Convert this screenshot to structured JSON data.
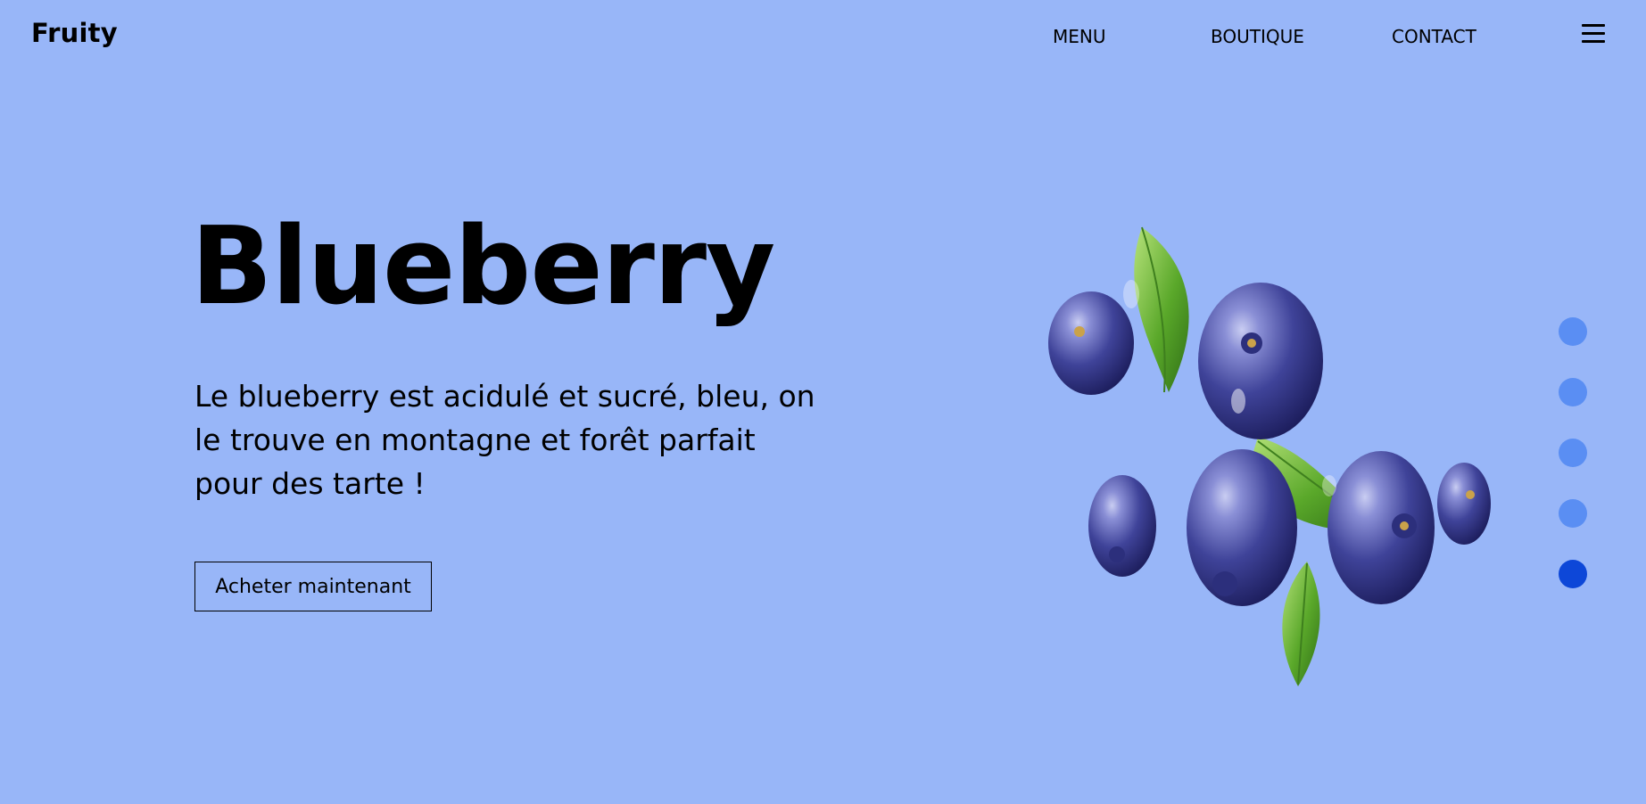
{
  "header": {
    "brand": "Fruity",
    "nav": [
      "MENU",
      "BOUTIQUE",
      "CONTACT"
    ],
    "menu_icon": "hamburger-icon"
  },
  "hero": {
    "title": "Blueberry",
    "description": "Le blueberry est acidulé et sucré, bleu, on le trouve en montagne et forêt parfait pour des tarte !",
    "cta_label": "Acheter maintenant",
    "image_subject": "blueberries-with-leaves"
  },
  "slider": {
    "count": 5,
    "active_index": 4
  },
  "colors": {
    "background": "#98b6f8",
    "dot": "#5a8ef3",
    "dot_active": "#0d47d8",
    "text": "#000000"
  }
}
